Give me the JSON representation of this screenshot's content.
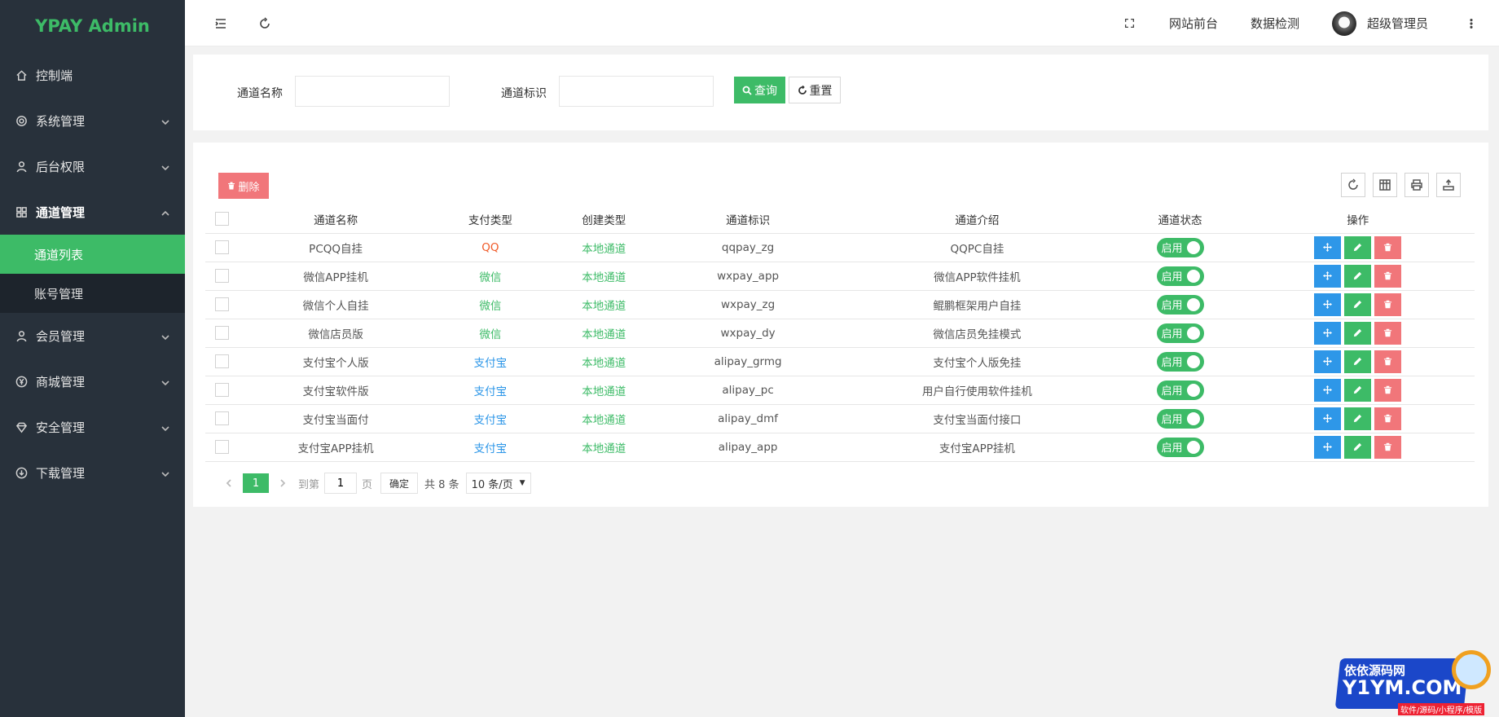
{
  "app": {
    "title": "YPAY Admin"
  },
  "sidebar": {
    "items": [
      {
        "label": "控制端",
        "icon": "home-icon",
        "has_children": false
      },
      {
        "label": "系统管理",
        "icon": "gear-icon",
        "has_children": true
      },
      {
        "label": "后台权限",
        "icon": "user-icon",
        "has_children": true
      },
      {
        "label": "通道管理",
        "icon": "apps-icon",
        "has_children": true,
        "open": true,
        "children": [
          {
            "label": "通道列表",
            "active": true
          },
          {
            "label": "账号管理"
          }
        ]
      },
      {
        "label": "会员管理",
        "icon": "user-icon",
        "has_children": true
      },
      {
        "label": "商城管理",
        "icon": "yen-icon",
        "has_children": true
      },
      {
        "label": "安全管理",
        "icon": "diamond-icon",
        "has_children": true
      },
      {
        "label": "下载管理",
        "icon": "download-icon",
        "has_children": true
      }
    ]
  },
  "header": {
    "links": [
      "网站前台",
      "数据检测"
    ],
    "user": "超级管理员"
  },
  "search": {
    "name_label": "通道名称",
    "name_value": "",
    "key_label": "通道标识",
    "key_value": "",
    "query_label": "查询",
    "reset_label": "重置"
  },
  "table": {
    "delete_label": "删除",
    "columns": [
      "通道名称",
      "支付类型",
      "创建类型",
      "通道标识",
      "通道介绍",
      "通道状态",
      "操作"
    ],
    "rows": [
      {
        "name": "PCQQ自挂",
        "pay_type": "QQ",
        "pay_class": "pay-qq",
        "create_type": "本地通道",
        "key": "qqpay_zg",
        "intro": "QQPC自挂",
        "status": "启用"
      },
      {
        "name": "微信APP挂机",
        "pay_type": "微信",
        "pay_class": "pay-wx",
        "create_type": "本地通道",
        "key": "wxpay_app",
        "intro": "微信APP软件挂机",
        "status": "启用"
      },
      {
        "name": "微信个人自挂",
        "pay_type": "微信",
        "pay_class": "pay-wx",
        "create_type": "本地通道",
        "key": "wxpay_zg",
        "intro": "鲲鹏框架用户自挂",
        "status": "启用"
      },
      {
        "name": "微信店员版",
        "pay_type": "微信",
        "pay_class": "pay-wx",
        "create_type": "本地通道",
        "key": "wxpay_dy",
        "intro": "微信店员免挂模式",
        "status": "启用"
      },
      {
        "name": "支付宝个人版",
        "pay_type": "支付宝",
        "pay_class": "pay-ali",
        "create_type": "本地通道",
        "key": "alipay_grmg",
        "intro": "支付宝个人版免挂",
        "status": "启用"
      },
      {
        "name": "支付宝软件版",
        "pay_type": "支付宝",
        "pay_class": "pay-ali",
        "create_type": "本地通道",
        "key": "alipay_pc",
        "intro": "用户自行使用软件挂机",
        "status": "启用"
      },
      {
        "name": "支付宝当面付",
        "pay_type": "支付宝",
        "pay_class": "pay-ali",
        "create_type": "本地通道",
        "key": "alipay_dmf",
        "intro": "支付宝当面付接口",
        "status": "启用"
      },
      {
        "name": "支付宝APP挂机",
        "pay_type": "支付宝",
        "pay_class": "pay-ali",
        "create_type": "本地通道",
        "key": "alipay_app",
        "intro": "支付宝APP挂机",
        "status": "启用"
      }
    ]
  },
  "pager": {
    "current": "1",
    "goto_label": "到第",
    "goto_value": "1",
    "page_label": "页",
    "ok_label": "确定",
    "total": "共 8 条",
    "page_size": "10 条/页"
  },
  "watermark": {
    "line1": "依依源码网",
    "line2": "Y1YM.COM",
    "line3": "软件/源码/小程序/模版"
  },
  "colors": {
    "accent": "#3dbb67",
    "danger": "#f1767a",
    "info": "#2e97e8",
    "sidebar": "#28313b",
    "qq": "#f05a28"
  }
}
